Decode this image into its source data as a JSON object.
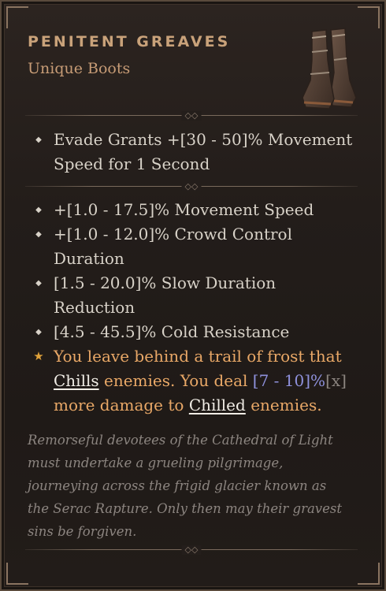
{
  "item": {
    "name": "PENITENT GREAVES",
    "type": "Unique Boots",
    "icon": "boots-icon"
  },
  "inherent": {
    "text": "Evade Grants +[30 - 50]% Movement Speed for 1 Second"
  },
  "affixes": [
    {
      "line1": "+[1.0 - 17.5]% Movement Speed"
    },
    {
      "line1": "+[1.0 - 12.0]% Crowd Control",
      "line2": "Duration"
    },
    {
      "line1": "[1.5 - 20.0]% Slow Duration",
      "line2": "Reduction"
    },
    {
      "line1": "[4.5 - 45.5]% Cold Resistance"
    }
  ],
  "unique_power": {
    "l1": "You leave behind a trail of frost that",
    "l2_kw": "Chills",
    "l2_mid": "enemies. You deal",
    "l2_num": "[7 - 10]%",
    "l2_x": "[x]",
    "l3_a": "more damage to",
    "l3_kw": "Chilled",
    "l3_b": "enemies."
  },
  "flavor": [
    "Remorseful devotees of the Cathedral of Light",
    "must undertake a grueling pilgrimage,",
    "journeying across the frigid glacier known as",
    "the Serac Rapture. Only then may their gravest",
    "sins be forgiven."
  ],
  "colors": {
    "title": "#c9a27a",
    "legendary": "#e9a867",
    "number": "#8f91dc",
    "flavor": "#8c8580"
  }
}
